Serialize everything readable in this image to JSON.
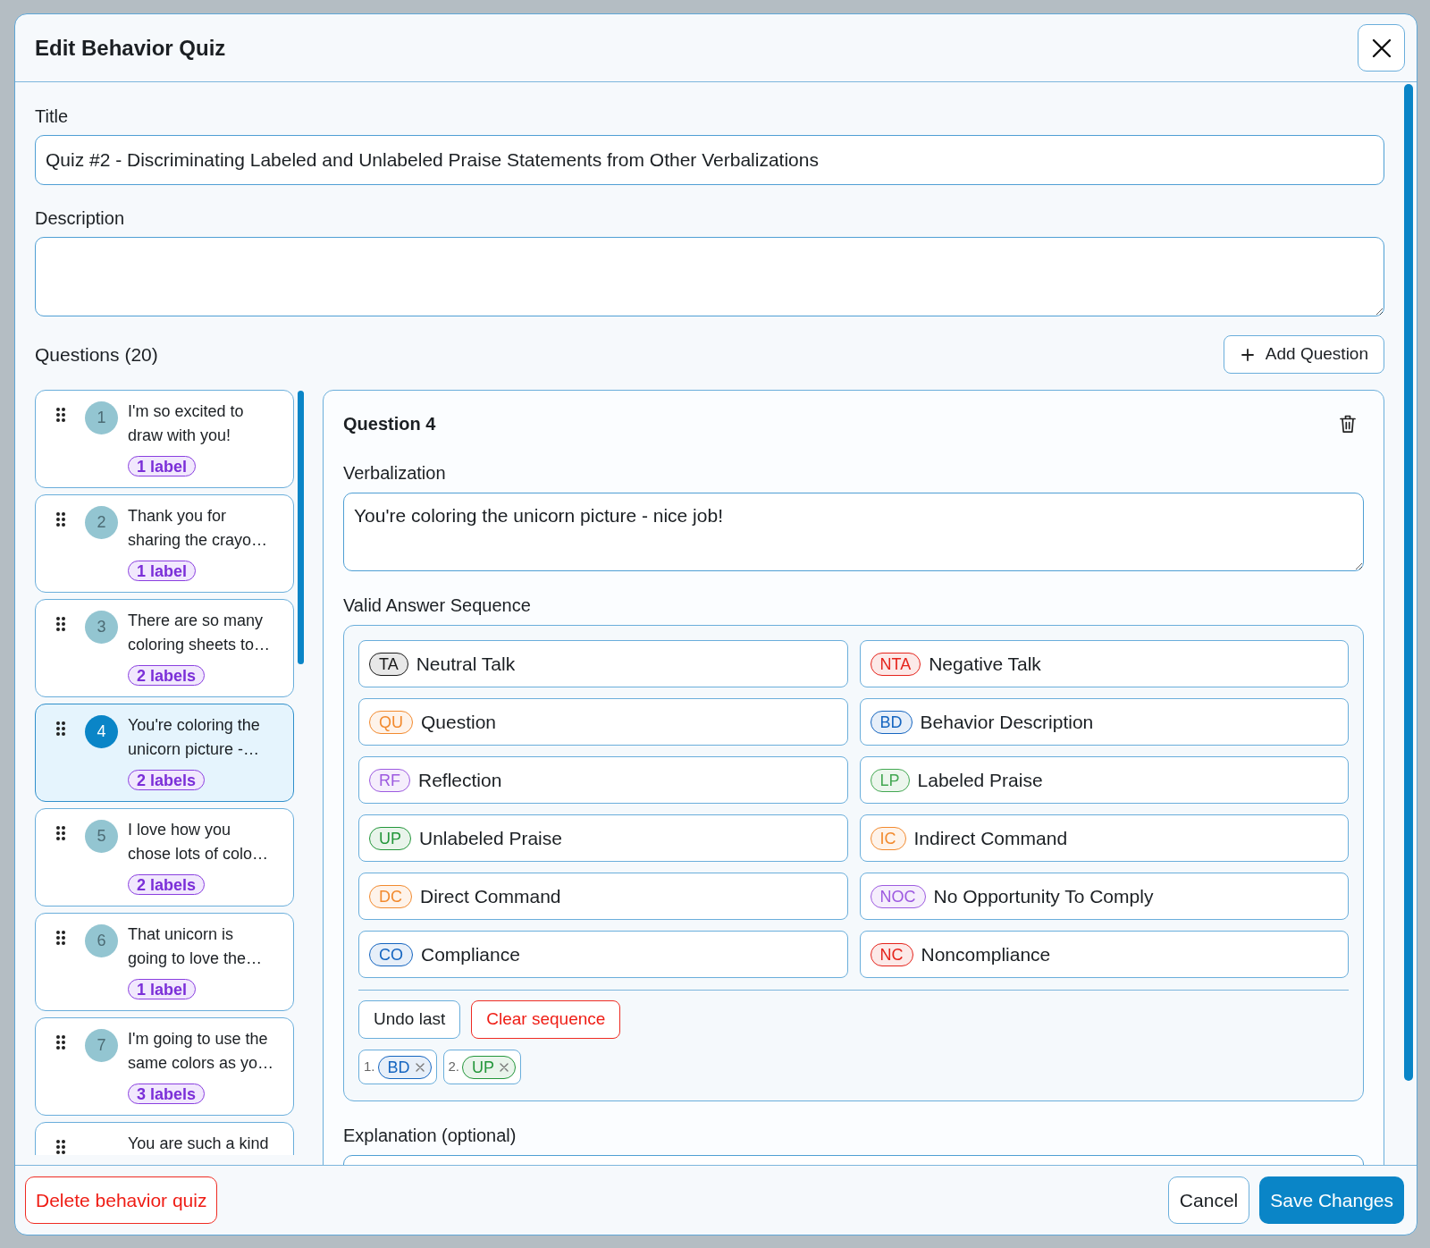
{
  "window": {
    "title": "Edit Behavior Quiz"
  },
  "form": {
    "title": {
      "label": "Title",
      "value": "Quiz #2 - Discriminating Labeled and Unlabeled Praise Statements from Other Verbalizations"
    },
    "description": {
      "label": "Description"
    }
  },
  "questions_header": {
    "label": "Questions (20)",
    "add_button": "Add Question"
  },
  "questions": [
    {
      "number": "1",
      "text": "I'm so excited to\ndraw with you!",
      "labels": "1 label",
      "selected": false
    },
    {
      "number": "2",
      "text": "Thank you for\nsharing the crayo…",
      "labels": "1 label",
      "selected": false
    },
    {
      "number": "3",
      "text": "There are so many\ncoloring sheets to…",
      "labels": "2 labels",
      "selected": false
    },
    {
      "number": "4",
      "text": "You're coloring the\nunicorn picture -…",
      "labels": "2 labels",
      "selected": true
    },
    {
      "number": "5",
      "text": "I love how you\nchose lots of colo…",
      "labels": "2 labels",
      "selected": false
    },
    {
      "number": "6",
      "text": "That unicorn is\ngoing to love the…",
      "labels": "1 label",
      "selected": false
    },
    {
      "number": "7",
      "text": "I'm going to use the\nsame colors as yo…",
      "labels": "3 labels",
      "selected": false
    },
    {
      "text": "You are such a kind",
      "selected": false
    }
  ],
  "editor": {
    "heading": "Question 4",
    "verbalization": {
      "label": "Verbalization",
      "value": "You're coloring the unicorn picture - nice job!"
    },
    "sequence": {
      "label": "Valid Answer Sequence",
      "answers": [
        {
          "code": "TA",
          "label": "Neutral Talk",
          "color": "#1a1a1a"
        },
        {
          "code": "NTA",
          "label": "Negative Talk",
          "color": "#e5231b"
        },
        {
          "code": "QU",
          "label": "Question",
          "color": "#f28a2e"
        },
        {
          "code": "BD",
          "label": "Behavior Description",
          "color": "#1565c0"
        },
        {
          "code": "RF",
          "label": "Reflection",
          "color": "#9d5ae0"
        },
        {
          "code": "LP",
          "label": "Labeled Praise",
          "color": "#43a852"
        },
        {
          "code": "UP",
          "label": "Unlabeled Praise",
          "color": "#23963a"
        },
        {
          "code": "IC",
          "label": "Indirect Command",
          "color": "#f28a2e"
        },
        {
          "code": "DC",
          "label": "Direct Command",
          "color": "#f28a2e"
        },
        {
          "code": "NOC",
          "label": "No Opportunity To Comply",
          "color": "#9d5ae0"
        },
        {
          "code": "CO",
          "label": "Compliance",
          "color": "#1565c0"
        },
        {
          "code": "NC",
          "label": "Noncompliance",
          "color": "#e5231b"
        }
      ],
      "undo": "Undo last",
      "clear": "Clear sequence",
      "chosen": [
        {
          "number": "1.",
          "code": "BD",
          "color": "#1565c0"
        },
        {
          "number": "2.",
          "code": "UP",
          "color": "#23963a"
        }
      ]
    },
    "explanation": {
      "label": "Explanation (optional)"
    }
  },
  "footer": {
    "delete": "Delete behavior quiz",
    "cancel": "Cancel",
    "save": "Save Changes"
  }
}
